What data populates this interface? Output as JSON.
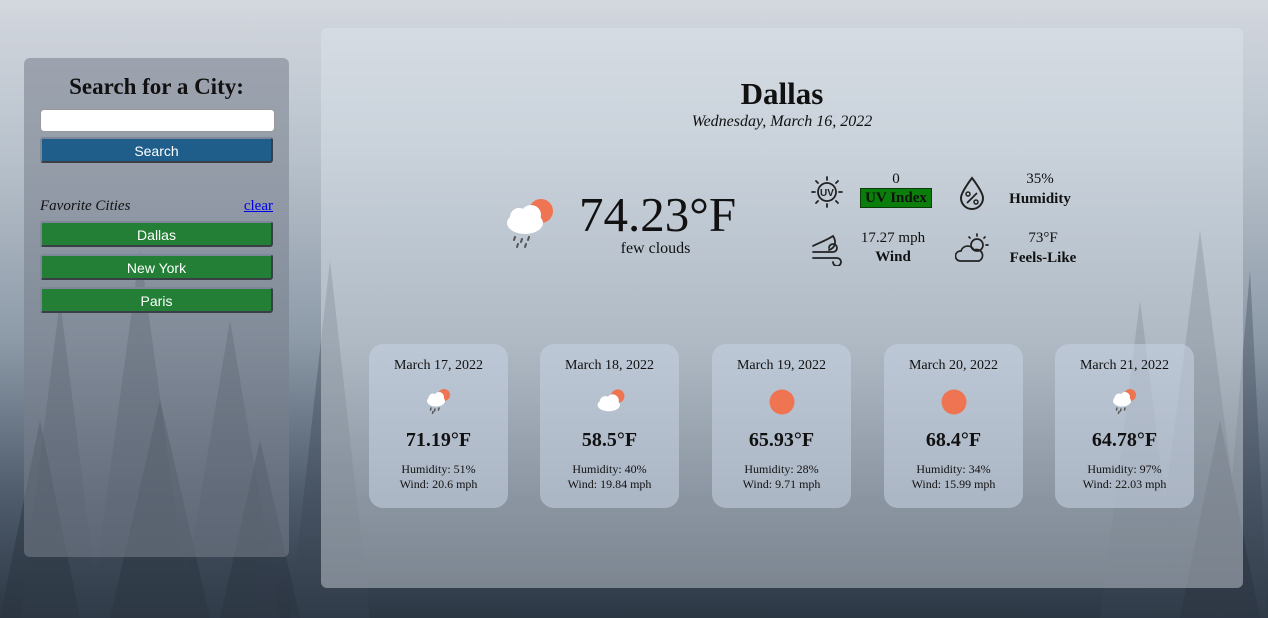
{
  "sidebar": {
    "title": "Search for a City:",
    "search_value": "",
    "search_button": "Search",
    "favorites_label": "Favorite Cities",
    "clear_label": "clear",
    "favorites": [
      "Dallas",
      "New York",
      "Paris"
    ]
  },
  "current": {
    "city": "Dallas",
    "date": "Wednesday, March 16, 2022",
    "icon": "rain-cloud-sun-icon",
    "temp": "74.23°F",
    "description": "few clouds",
    "uv_value": "0",
    "uv_label": "UV Index",
    "uv_color": "#0a7d0a",
    "humidity_value": "35%",
    "humidity_label": "Humidity",
    "wind_value": "17.27 mph",
    "wind_label": "Wind",
    "feels_value": "73°F",
    "feels_label": "Feels-Like"
  },
  "forecast": [
    {
      "date": "March 17, 2022",
      "icon": "rain-cloud-sun-icon",
      "temp": "71.19°F",
      "humidity": "Humidity: 51%",
      "wind": "Wind: 20.6 mph"
    },
    {
      "date": "March 18, 2022",
      "icon": "cloud-sun-icon",
      "temp": "58.5°F",
      "humidity": "Humidity: 40%",
      "wind": "Wind: 19.84 mph"
    },
    {
      "date": "March 19, 2022",
      "icon": "sun-icon",
      "temp": "65.93°F",
      "humidity": "Humidity: 28%",
      "wind": "Wind: 9.71 mph"
    },
    {
      "date": "March 20, 2022",
      "icon": "sun-icon",
      "temp": "68.4°F",
      "humidity": "Humidity: 34%",
      "wind": "Wind: 15.99 mph"
    },
    {
      "date": "March 21, 2022",
      "icon": "rain-cloud-sun-icon",
      "temp": "64.78°F",
      "humidity": "Humidity: 97%",
      "wind": "Wind: 22.03 mph"
    }
  ],
  "colors": {
    "search_button": "#1f5d8b",
    "city_button": "#237f36",
    "sun": "#ee7452"
  }
}
